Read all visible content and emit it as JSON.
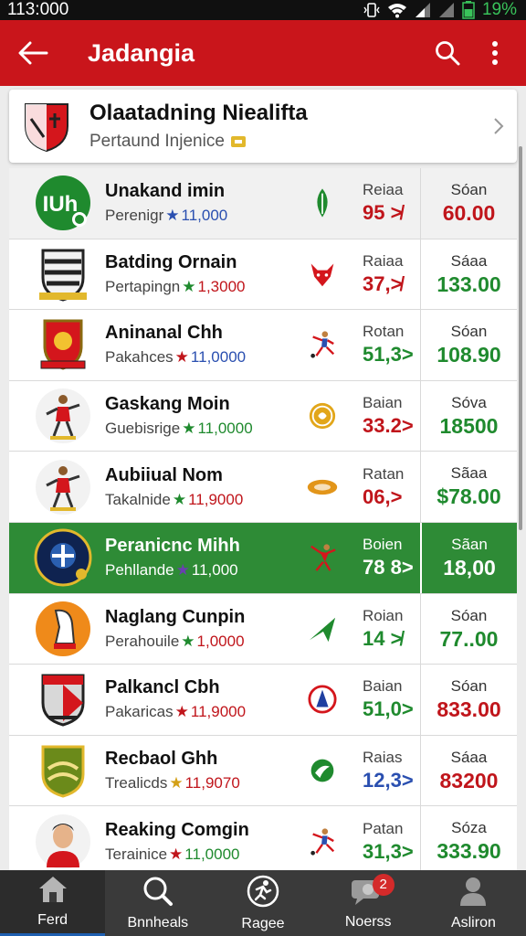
{
  "status": {
    "time": "113:000",
    "battery": "19%"
  },
  "appbar": {
    "title": "Jadangia"
  },
  "header": {
    "title": "Olaatadning Niealifta",
    "subtitle": "Pertaund Injenice"
  },
  "teams": [
    {
      "name": "Unakand imin",
      "sub": "Perenigr",
      "sub_value": "11,000",
      "star_color": "#2a4fb0",
      "sub_value_color": "#2a4fb0",
      "rate_label": "Reiaa",
      "rate_value": "95 ≯",
      "rate_color": "#c0151b",
      "score_label": "Sóan",
      "score_value": "60.00",
      "score_color": "#c0151b",
      "logo_text": "IUh",
      "logo_icon": "green-circle-badge-icon",
      "mid_icon": "leaf-icon"
    },
    {
      "name": "Batding Ornain",
      "sub": "Pertapingn",
      "sub_value": "1,3000",
      "star_color": "#1f8a2e",
      "sub_value_color": "#c0151b",
      "rate_label": "Raiaa",
      "rate_value": "37,≯",
      "rate_color": "#c0151b",
      "score_label": "Sáaa",
      "score_value": "133.00",
      "score_color": "#1f8a2e",
      "logo_text": "",
      "logo_icon": "striped-shield-crest-icon",
      "mid_icon": "bull-head-icon"
    },
    {
      "name": "Aninanal Chh",
      "sub": "Pakahces",
      "sub_value": "11,0000",
      "star_color": "#c0151b",
      "sub_value_color": "#2a4fb0",
      "rate_label": "Rotan",
      "rate_value": "51,3>",
      "rate_color": "#1f8a2e",
      "score_label": "Sóan",
      "score_value": "108.90",
      "score_color": "#1f8a2e",
      "logo_text": "",
      "logo_icon": "red-shield-crest-icon",
      "mid_icon": "player-kick-icon"
    },
    {
      "name": "Gaskang Moin",
      "sub": "Guebisrige",
      "sub_value": "11,0000",
      "star_color": "#1f8a2e",
      "sub_value_color": "#1f8a2e",
      "rate_label": "Baian",
      "rate_value": "33.2>",
      "rate_color": "#c0151b",
      "score_label": "Sóva",
      "score_value": "18500",
      "score_color": "#1f8a2e",
      "logo_text": "",
      "logo_icon": "player-portrait-icon",
      "mid_icon": "gold-coin-icon"
    },
    {
      "name": "Aubiiual Nom",
      "sub": "Takalnide",
      "sub_value": "11,9000",
      "star_color": "#1f8a2e",
      "sub_value_color": "#c0151b",
      "rate_label": "Ratan",
      "rate_value": "06,>",
      "rate_color": "#c0151b",
      "score_label": "Sãaa",
      "score_value": "$78.00",
      "score_color": "#1f8a2e",
      "logo_text": "",
      "logo_icon": "player-portrait-icon",
      "mid_icon": "orange-disc-icon"
    },
    {
      "name": "Peranicnc Mihh",
      "sub": "Pehllande",
      "sub_value": "11,000",
      "star_color": "#6a3fb0",
      "sub_value_color": "#ffffff",
      "rate_label": "Boien",
      "rate_value": "78 8>",
      "rate_color": "#ffffff",
      "score_label": "Sãan",
      "score_value": "18,00",
      "score_color": "#ffffff",
      "logo_text": "",
      "logo_icon": "navy-round-crest-icon",
      "mid_icon": "player-jump-icon"
    },
    {
      "name": "Naglang Cunpin",
      "sub": "Perahouile",
      "sub_value": "1,0000",
      "star_color": "#1f8a2e",
      "sub_value_color": "#c0151b",
      "rate_label": "Roian",
      "rate_value": "14 ≯",
      "rate_color": "#1f8a2e",
      "score_label": "Sóan",
      "score_value": "77..00",
      "score_color": "#1f8a2e",
      "logo_text": "",
      "logo_icon": "horse-head-crest-icon",
      "mid_icon": "green-arrow-icon"
    },
    {
      "name": "Palkancl Cbh",
      "sub": "Pakaricas",
      "sub_value": "11,9000",
      "star_color": "#c0151b",
      "sub_value_color": "#c0151b",
      "rate_label": "Baian",
      "rate_value": "51,0>",
      "rate_color": "#1f8a2e",
      "score_label": "Sóan",
      "score_value": "833.00",
      "score_color": "#c0151b",
      "logo_text": "",
      "logo_icon": "grey-shield-crest-icon",
      "mid_icon": "round-team-badge-icon"
    },
    {
      "name": "Recbaol Ghh",
      "sub": "Trealicds",
      "sub_value": "11,9070",
      "star_color": "#d4a017",
      "sub_value_color": "#c0151b",
      "rate_label": "Raias",
      "rate_value": "12,3>",
      "rate_color": "#2a4fb0",
      "score_label": "Sáaa",
      "score_value": "83200",
      "score_color": "#c0151b",
      "logo_text": "",
      "logo_icon": "olive-shield-crest-icon",
      "mid_icon": "green-bird-icon"
    },
    {
      "name": "Reaking Comgin",
      "sub": "Terainice",
      "sub_value": "11,0000",
      "star_color": "#c0151b",
      "sub_value_color": "#1f8a2e",
      "rate_label": "Patan",
      "rate_value": "31,3>",
      "rate_color": "#1f8a2e",
      "score_label": "Sóza",
      "score_value": "333.90",
      "score_color": "#1f8a2e",
      "logo_text": "",
      "logo_icon": "person-portrait-icon",
      "mid_icon": "player-kick-icon"
    }
  ],
  "nav": [
    {
      "label": "Ferd",
      "icon": "home-icon"
    },
    {
      "label": "Bnnheals",
      "icon": "search-icon"
    },
    {
      "label": "Ragee",
      "icon": "runner-icon"
    },
    {
      "label": "Noerss",
      "icon": "chat-icon",
      "badge": "2"
    },
    {
      "label": "Asliron",
      "icon": "profile-icon"
    }
  ]
}
